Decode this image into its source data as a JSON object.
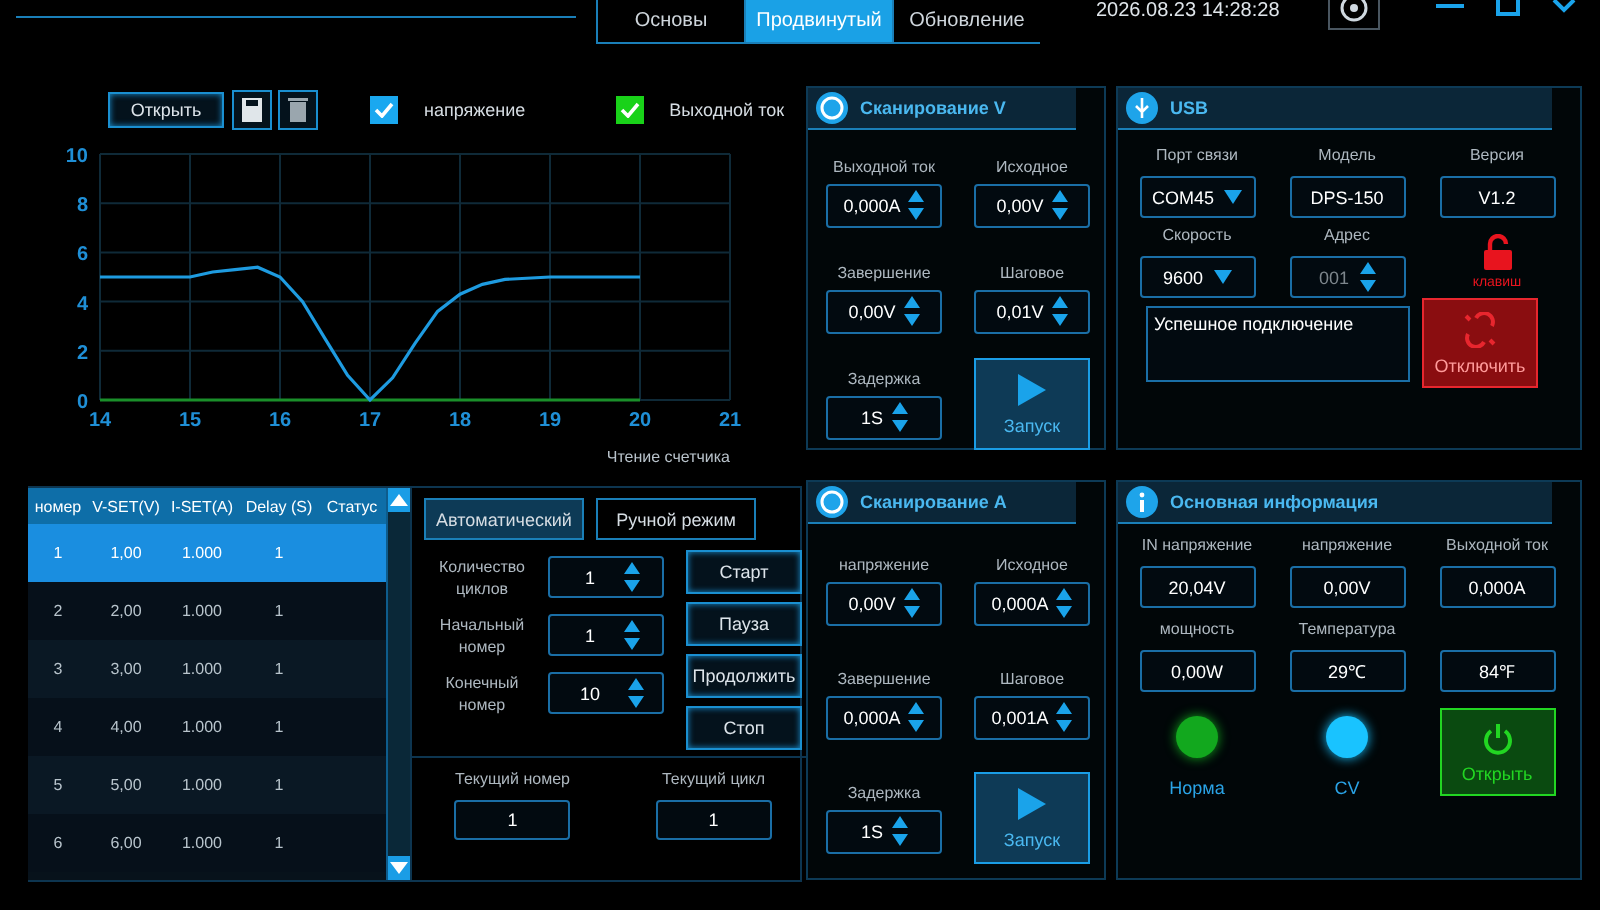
{
  "window": {
    "date_time": "2026.08.23 14:28:28"
  },
  "tabs": [
    {
      "label": "Основы",
      "selected": false
    },
    {
      "label": "Продвинутый",
      "selected": true
    },
    {
      "label": "Обновление",
      "selected": false
    }
  ],
  "graph": {
    "open_button": "Открыть",
    "legend": [
      {
        "checked": true,
        "color": "#1aa8f0"
      },
      {
        "checked": true,
        "color": "#19d219"
      }
    ],
    "chart_data": {
      "type": "line",
      "grid": true,
      "xlabel": "Чтение счетчика",
      "x": [
        14,
        14.5,
        15,
        15.25,
        15.5,
        15.75,
        16,
        16.25,
        16.5,
        16.75,
        17,
        17.25,
        17.5,
        17.75,
        18,
        18.25,
        18.5,
        19,
        19.5,
        20
      ],
      "series": [
        {
          "name": "напряжение",
          "color": "#1e9be0",
          "values": [
            5,
            5,
            5,
            5.2,
            5.3,
            5.4,
            5,
            4,
            2.5,
            1,
            0,
            0.9,
            2.3,
            3.6,
            4.3,
            4.7,
            4.9,
            5,
            5,
            5
          ]
        },
        {
          "name": "Выходной ток",
          "color": "#1a8f2a",
          "values": [
            0,
            0,
            0,
            0,
            0,
            0,
            0,
            0,
            0,
            0,
            0,
            0,
            0,
            0,
            0,
            0,
            0,
            0,
            0,
            0
          ]
        }
      ],
      "xlim": [
        14,
        21
      ],
      "ylim": [
        0,
        10
      ],
      "xticks": [
        14,
        15,
        16,
        17,
        18,
        19,
        20,
        21
      ],
      "yticks": [
        0,
        2,
        4,
        6,
        8,
        10
      ]
    }
  },
  "table": {
    "columns": [
      "номер",
      "V-SET(V)",
      "I-SET(A)",
      "Delay (S)",
      "Статус"
    ],
    "rows": [
      {
        "cells": [
          "1",
          "1,00",
          "1.000",
          "1"
        ],
        "selected": true
      },
      {
        "cells": [
          "2",
          "2,00",
          "1.000",
          "1"
        ],
        "selected": false
      },
      {
        "cells": [
          "3",
          "3,00",
          "1.000",
          "1"
        ],
        "selected": false
      },
      {
        "cells": [
          "4",
          "4,00",
          "1.000",
          "1"
        ],
        "selected": false
      },
      {
        "cells": [
          "5",
          "5,00",
          "1.000",
          "1"
        ],
        "selected": false
      },
      {
        "cells": [
          "6",
          "6,00",
          "1.000",
          "1"
        ],
        "selected": false
      }
    ]
  },
  "sequence": {
    "modes": [
      {
        "label": "Автоматический",
        "selected": true
      },
      {
        "label": "Ручной режим",
        "selected": false
      }
    ],
    "fields": [
      {
        "label": "Количество циклов",
        "value": "1"
      },
      {
        "label": "Начальный номер",
        "value": "1"
      },
      {
        "label": "Конечный номер",
        "value": "10"
      }
    ],
    "buttons": [
      "Старт",
      "Пауза",
      "Продолжить",
      "Стоп"
    ],
    "counters": [
      {
        "label": "Текущий номер",
        "value": "1"
      },
      {
        "label": "Текущий цикл",
        "value": "1"
      }
    ]
  },
  "scans": [
    {
      "title": "Сканирование V",
      "fields": [
        {
          "label": "Выходной ток",
          "value": "0,000A"
        },
        {
          "label": "Исходное",
          "value": "0,00V"
        },
        {
          "label": "Завершение",
          "value": "0,00V"
        },
        {
          "label": "Шаговое",
          "value": "0,01V"
        },
        {
          "label": "Задержка",
          "value": "1S"
        }
      ],
      "run_button": "Запуск"
    },
    {
      "title": "Сканирование А",
      "fields": [
        {
          "label": "напряжение",
          "value": "0,00V"
        },
        {
          "label": "Исходное",
          "value": "0,000A"
        },
        {
          "label": "Завершение",
          "value": "0,000A"
        },
        {
          "label": "Шаговое",
          "value": "0,001A"
        },
        {
          "label": "Задержка",
          "value": "1S"
        }
      ],
      "run_button": "Запуск"
    }
  ],
  "usb": {
    "title": "USB",
    "fields": [
      {
        "label": "Порт связи",
        "value": "COM45",
        "kind": "dropdown",
        "disabled": false
      },
      {
        "label": "Модель",
        "value": "DPS-150",
        "kind": "text",
        "disabled": false
      },
      {
        "label": "Версия",
        "value": "V1.2",
        "kind": "text",
        "disabled": false
      },
      {
        "label": "Скорость",
        "value": "9600",
        "kind": "dropdown",
        "disabled": false
      },
      {
        "label": "Адрес",
        "value": "001",
        "kind": "spin",
        "disabled": true
      }
    ],
    "lock_label": "клавиш",
    "status": "Успешное подключение",
    "disconnect_button": "Отключить"
  },
  "info": {
    "title": "Основная информация",
    "fields": [
      {
        "label": "IN напряжение",
        "value": "20,04V"
      },
      {
        "label": "напряжение",
        "value": "0,00V"
      },
      {
        "label": "Выходной ток",
        "value": "0,000A"
      },
      {
        "label": "мощность",
        "value": "0,00W"
      },
      {
        "label": "Температура",
        "value": "29℃"
      },
      {
        "value": "84℉"
      }
    ],
    "indicators": [
      {
        "label": "Норма",
        "color": "#12a81e"
      },
      {
        "label": "CV",
        "color": "#19c3ff"
      }
    ],
    "power_button": "Открыть"
  }
}
